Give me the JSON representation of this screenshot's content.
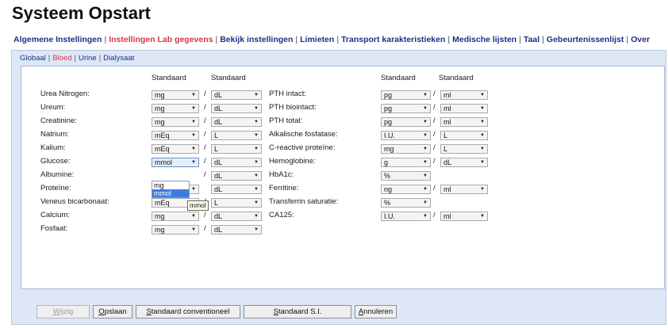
{
  "page_title": "Systeem Opstart",
  "main_tabs": [
    {
      "label": "Algemene Instellingen",
      "active": false
    },
    {
      "label": "Instellingen Lab gegevens",
      "active": true
    },
    {
      "label": "Bekijk instellingen",
      "active": false
    },
    {
      "label": "Limieten",
      "active": false
    },
    {
      "label": "Transport karakteristieken",
      "active": false
    },
    {
      "label": "Medische lijsten",
      "active": false
    },
    {
      "label": "Taal",
      "active": false
    },
    {
      "label": "Gebeurtenissenlijst",
      "active": false
    },
    {
      "label": "Over",
      "active": false
    }
  ],
  "sub_tabs": [
    {
      "label": "Globaal",
      "active": false
    },
    {
      "label": "Bloed",
      "active": true
    },
    {
      "label": "Urine",
      "active": false
    },
    {
      "label": "Dialysaat",
      "active": false
    }
  ],
  "column_header": "Standaard",
  "separator": "/",
  "left_rows": [
    {
      "label": "Urea Nitrogen:",
      "unit": "mg",
      "per": "dL"
    },
    {
      "label": "Ureum:",
      "unit": "mg",
      "per": "dL"
    },
    {
      "label": "Creatinine:",
      "unit": "mg",
      "per": "dL"
    },
    {
      "label": "Natrium:",
      "unit": "mEq",
      "per": "L"
    },
    {
      "label": "Kalium:",
      "unit": "mEq",
      "per": "L"
    },
    {
      "label": "Glucose:",
      "unit": "mmol",
      "per": "dL"
    },
    {
      "label": "Albumine:",
      "unit": "",
      "per": "dL"
    },
    {
      "label": "Proteïne:",
      "unit": "g",
      "per": "dL"
    },
    {
      "label": "Veneus bicarbonaat:",
      "unit": "mEq",
      "per": "L"
    },
    {
      "label": "Calcium:",
      "unit": "mg",
      "per": "dL"
    },
    {
      "label": "Fosfaat:",
      "unit": "mg",
      "per": "dL"
    }
  ],
  "right_rows": [
    {
      "label": "PTH intact:",
      "unit": "pg",
      "per": "ml"
    },
    {
      "label": "PTH biointact:",
      "unit": "pg",
      "per": "ml"
    },
    {
      "label": "PTH total:",
      "unit": "pg",
      "per": "ml"
    },
    {
      "label": "Alkalische fosfatase:",
      "unit": "I.U.",
      "per": "L"
    },
    {
      "label": "C-reactive proteïne:",
      "unit": "mg",
      "per": "L"
    },
    {
      "label": "Hemoglobine:",
      "unit": "g",
      "per": "dL"
    },
    {
      "label": "HbA1c:",
      "unit": "%",
      "per": null
    },
    {
      "label": "Ferritine:",
      "unit": "ng",
      "per": "ml"
    },
    {
      "label": "Transferrin saturatie:",
      "unit": "%",
      "per": null
    },
    {
      "label": "CA125:",
      "unit": "I.U.",
      "per": "ml"
    }
  ],
  "dropdown_open": {
    "options": [
      "mg",
      "mmol"
    ],
    "highlighted": "mmol"
  },
  "tooltip": "mmol",
  "buttons": [
    {
      "label": "Wijzig",
      "mnemonic": "W",
      "disabled": true
    },
    {
      "label": "Opslaan",
      "mnemonic": "O",
      "disabled": false
    },
    {
      "label": "Standaard conventioneel",
      "mnemonic": "S",
      "disabled": false
    },
    {
      "label": "Standaard S.I.",
      "mnemonic": "S",
      "disabled": false
    },
    {
      "label": "Annuleren",
      "mnemonic": "A",
      "disabled": false
    }
  ],
  "colors": {
    "active_tab": "#e0344a",
    "tab_text": "#1d2f8c",
    "panel_bg": "#dde7f5",
    "highlight": "#3b7be0"
  }
}
